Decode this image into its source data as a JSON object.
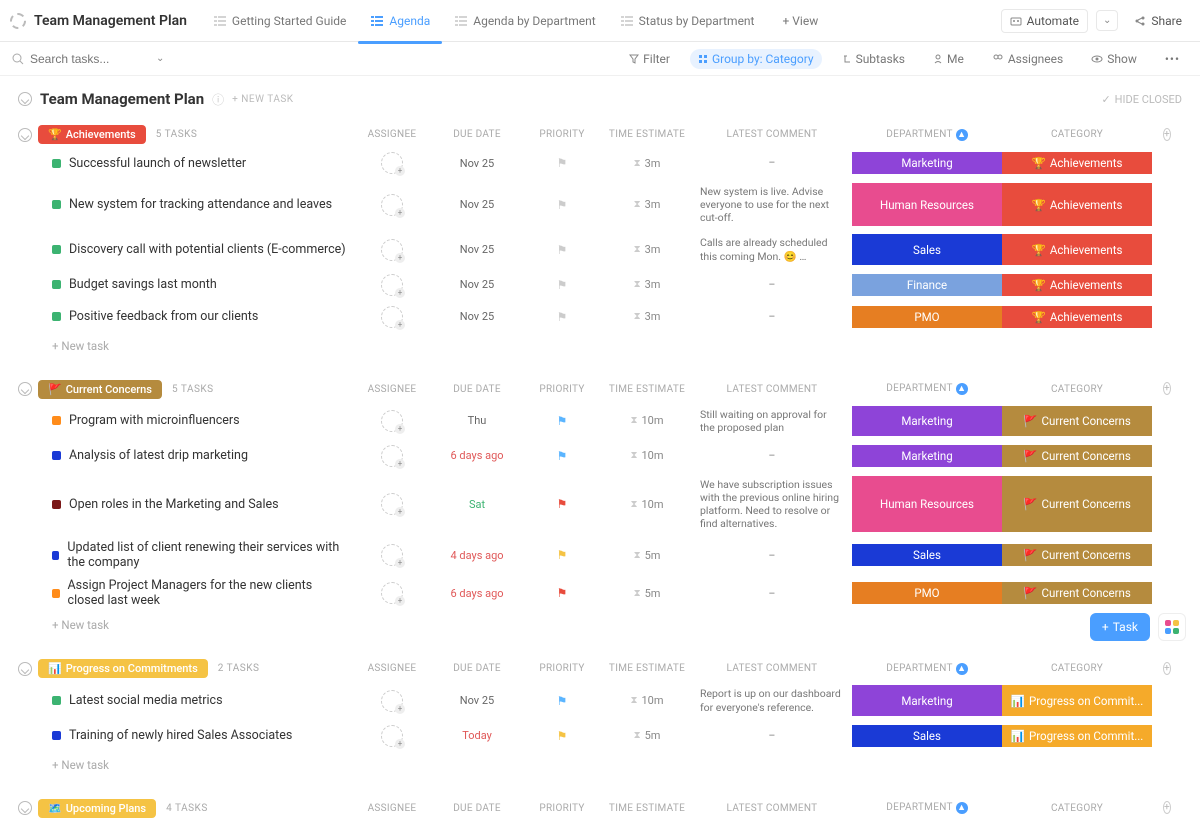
{
  "header": {
    "doc_title": "Team Management Plan",
    "views": [
      {
        "name": "Getting Started Guide",
        "active": false
      },
      {
        "name": "Agenda",
        "active": true
      },
      {
        "name": "Agenda by Department",
        "active": false
      },
      {
        "name": "Status by Department",
        "active": false
      }
    ],
    "add_view": "+ View",
    "automate": "Automate",
    "share": "Share"
  },
  "filterbar": {
    "search_placeholder": "Search tasks...",
    "filter": "Filter",
    "group_by": "Group by: Category",
    "subtasks": "Subtasks",
    "me": "Me",
    "assignees": "Assignees",
    "show": "Show"
  },
  "page": {
    "title": "Team Management Plan",
    "new_task_hdr": "+ NEW TASK",
    "hide_closed": "HIDE CLOSED"
  },
  "columns": {
    "assignee": "ASSIGNEE",
    "due": "DUE DATE",
    "priority": "PRIORITY",
    "time": "TIME ESTIMATE",
    "comment": "LATEST COMMENT",
    "dept": "DEPARTMENT",
    "cat": "CATEGORY"
  },
  "colors": {
    "achievements_chip": "#e84c3d",
    "concerns_chip": "#b58b3e",
    "progress_chip": "#f5c344",
    "upcoming_chip": "#f5c344",
    "dept": {
      "Marketing": "#8e44d8",
      "Human Resources": "#e84c8f",
      "Sales": "#1a3ad6",
      "Finance": "#7aa2de",
      "PMO": "#e67e22"
    },
    "cat": {
      "Achievements": "#e84c3d",
      "Current Concerns": "#b58b3e",
      "Progress on Commit...": "#f5aa2a"
    }
  },
  "groups": [
    {
      "id": "achievements",
      "chip": "Achievements",
      "chip_icon": "🏆",
      "chip_color": "#e84c3d",
      "count": "5 TASKS",
      "rows": [
        {
          "bullet": "#3cb371",
          "name": "Successful launch of newsletter",
          "due": "Nov 25",
          "due_cls": "",
          "flag": "gray",
          "time": "3m",
          "comment": "–",
          "dept": "Marketing",
          "cat": "Achievements",
          "cat_icon": "🏆"
        },
        {
          "bullet": "#3cb371",
          "name": "New system for tracking attendance and leaves",
          "due": "Nov 25",
          "due_cls": "",
          "flag": "gray",
          "time": "3m",
          "comment": "New system is live. Advise everyone to use for the next cut-off.",
          "dept": "Human Resources",
          "cat": "Achievements",
          "cat_icon": "🏆"
        },
        {
          "bullet": "#3cb371",
          "name": "Discovery call with potential clients (E-commerce)",
          "due": "Nov 25",
          "due_cls": "",
          "flag": "gray",
          "time": "3m",
          "comment": "Calls are already scheduled this coming Mon. 😊 …",
          "dept": "Sales",
          "cat": "Achievements",
          "cat_icon": "🏆"
        },
        {
          "bullet": "#3cb371",
          "name": "Budget savings last month",
          "due": "Nov 25",
          "due_cls": "",
          "flag": "gray",
          "time": "3m",
          "comment": "–",
          "dept": "Finance",
          "cat": "Achievements",
          "cat_icon": "🏆"
        },
        {
          "bullet": "#3cb371",
          "name": "Positive feedback from our clients",
          "due": "Nov 25",
          "due_cls": "",
          "flag": "gray",
          "time": "3m",
          "comment": "–",
          "dept": "PMO",
          "cat": "Achievements",
          "cat_icon": "🏆"
        }
      ],
      "new_task": "+ New task"
    },
    {
      "id": "concerns",
      "chip": "Current Concerns",
      "chip_icon": "🚩",
      "chip_color": "#b58b3e",
      "count": "5 TASKS",
      "rows": [
        {
          "bullet": "#ff8c1a",
          "name": "Program with microinfluencers",
          "due": "Thu",
          "due_cls": "",
          "flag": "blue",
          "time": "10m",
          "comment": "Still waiting on approval for the proposed plan",
          "dept": "Marketing",
          "cat": "Current Concerns",
          "cat_icon": "🚩"
        },
        {
          "bullet": "#1a3ad6",
          "name": "Analysis of latest drip marketing",
          "due": "6 days ago",
          "due_cls": "red",
          "flag": "blue",
          "time": "10m",
          "comment": "–",
          "dept": "Marketing",
          "cat": "Current Concerns",
          "cat_icon": "🚩"
        },
        {
          "bullet": "#7a1818",
          "name": "Open roles in the Marketing and Sales",
          "due": "Sat",
          "due_cls": "green",
          "flag": "red",
          "time": "10m",
          "comment": "We have subscription issues with the previous online hiring platform. Need to resolve or find alternatives.",
          "dept": "Human Resources",
          "cat": "Current Concerns",
          "cat_icon": "🚩"
        },
        {
          "bullet": "#1a3ad6",
          "name": "Updated list of client renewing their services with the company",
          "due": "4 days ago",
          "due_cls": "red",
          "flag": "yellow",
          "time": "5m",
          "comment": "–",
          "dept": "Sales",
          "cat": "Current Concerns",
          "cat_icon": "🚩"
        },
        {
          "bullet": "#ff8c1a",
          "name": "Assign Project Managers for the new clients closed last week",
          "due": "6 days ago",
          "due_cls": "red",
          "flag": "red",
          "time": "5m",
          "comment": "–",
          "dept": "PMO",
          "cat": "Current Concerns",
          "cat_icon": "🚩"
        }
      ],
      "new_task": "+ New task"
    },
    {
      "id": "progress",
      "chip": "Progress on Commitments",
      "chip_icon": "📊",
      "chip_color": "#f5c344",
      "count": "2 TASKS",
      "rows": [
        {
          "bullet": "#3cb371",
          "name": "Latest social media metrics",
          "due": "Nov 25",
          "due_cls": "",
          "flag": "blue",
          "time": "10m",
          "comment": "Report is up on our dashboard for everyone's reference.",
          "dept": "Marketing",
          "cat": "Progress on Commit...",
          "cat_icon": "📊"
        },
        {
          "bullet": "#1a3ad6",
          "name": "Training of newly hired Sales Associates",
          "due": "Today",
          "due_cls": "red",
          "flag": "yellow",
          "time": "5m",
          "comment": "–",
          "dept": "Sales",
          "cat": "Progress on Commit...",
          "cat_icon": "📊"
        }
      ],
      "new_task": "+ New task"
    },
    {
      "id": "upcoming",
      "chip": "Upcoming Plans",
      "chip_icon": "🗺️",
      "chip_color": "#f5c344",
      "count": "4 TASKS",
      "rows": [],
      "new_task": ""
    }
  ],
  "footer": {
    "task_btn": "Task"
  }
}
